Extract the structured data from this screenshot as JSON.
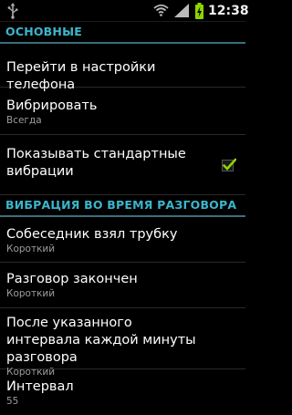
{
  "status_bar": {
    "time": "12:38",
    "icons": [
      "usb-icon",
      "wifi-icon",
      "signal-icon",
      "battery-charging-icon"
    ]
  },
  "sections": [
    {
      "header": "ОСНОВНЫЕ",
      "items": [
        {
          "title": "Перейти в настройки телефона"
        },
        {
          "title": "Вибрировать",
          "summary": "Всегда"
        },
        {
          "title": "Показывать стандартные вибрации",
          "checked": true
        }
      ]
    },
    {
      "header": "ВИБРАЦИЯ ВО ВРЕМЯ РАЗГОВОРА",
      "items": [
        {
          "title": "Собеседник взял трубку",
          "summary": "Короткий"
        },
        {
          "title": "Разговор закончен",
          "summary": "Короткий"
        },
        {
          "title": "После указанного интервала каждой минуты разговора",
          "summary": "Короткий"
        },
        {
          "title": "Интервал",
          "summary": "55"
        }
      ]
    }
  ],
  "colors": {
    "header_text": "#3bb6cc",
    "header_rule": "#3a6f7c",
    "checkmark": "#8fd400",
    "summary_text": "#9d9d9d"
  }
}
